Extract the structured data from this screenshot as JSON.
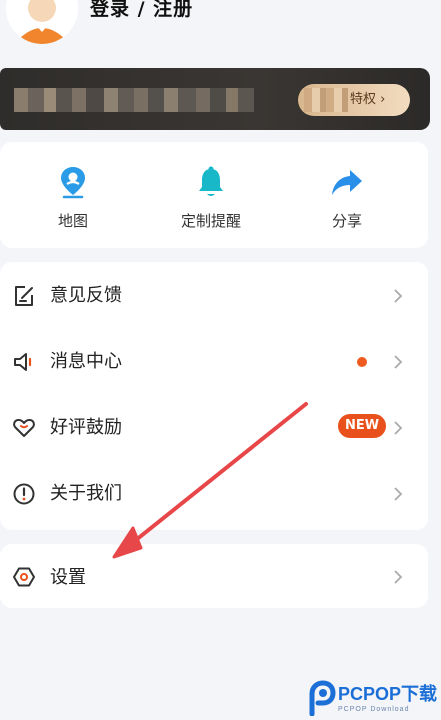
{
  "header": {
    "login_label": "登录 / 注册"
  },
  "vip_banner": {
    "button_label": "特权 ›"
  },
  "quick_actions": [
    {
      "label": "地图",
      "icon": "map-pin-icon"
    },
    {
      "label": "定制提醒",
      "icon": "bell-icon"
    },
    {
      "label": "分享",
      "icon": "share-arrow-icon"
    }
  ],
  "menu": [
    {
      "label": "意见反馈",
      "icon": "feedback-edit-icon"
    },
    {
      "label": "消息中心",
      "icon": "speaker-icon",
      "indicator": "dot"
    },
    {
      "label": "好评鼓励",
      "icon": "heart-icon",
      "badge": "NEW"
    },
    {
      "label": "关于我们",
      "icon": "info-icon"
    }
  ],
  "settings": {
    "label": "设置",
    "icon": "settings-hex-icon"
  },
  "watermark": {
    "brand": "PCPOP",
    "suffix": "下载",
    "sub": "PCPOP Download"
  },
  "colors": {
    "accent": "#1f8fe0",
    "badge": "#e8501c",
    "arrow": "#e8474a",
    "background": "#f4f5f8"
  }
}
